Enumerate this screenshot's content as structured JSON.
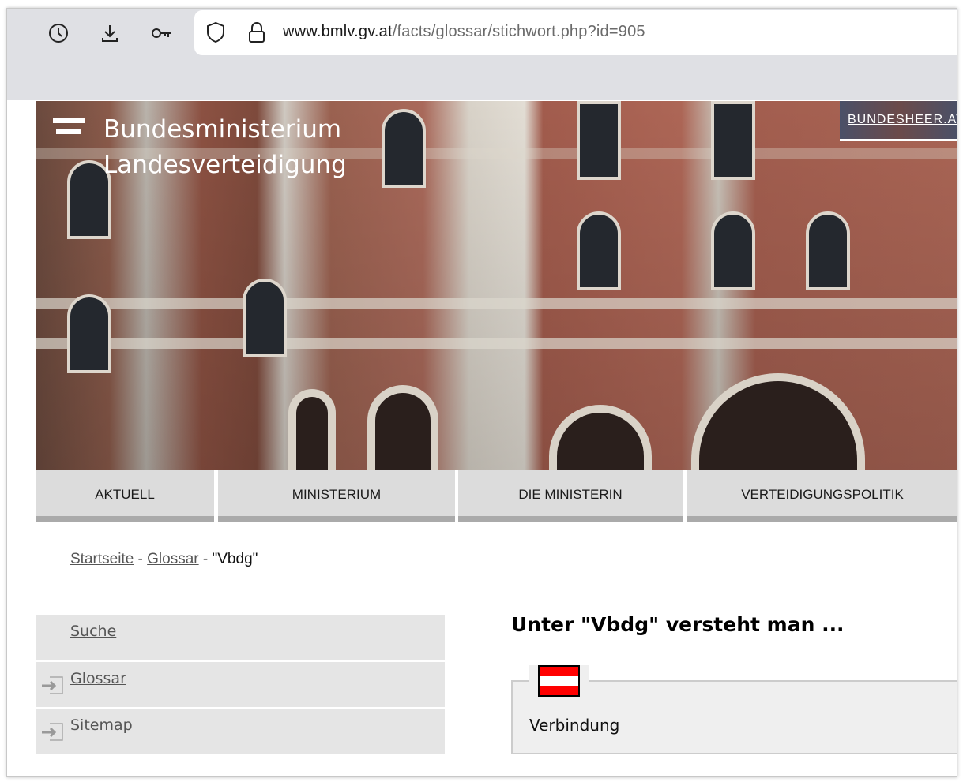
{
  "browser": {
    "url_host": "www.bmlv.gv.at",
    "url_path": "/facts/glossar/stichwort.php?id=905",
    "icons": [
      "history-icon",
      "download-icon",
      "key-icon",
      "shield-icon",
      "lock-icon"
    ]
  },
  "header": {
    "logo_line1": "Bundesministerium",
    "logo_line2": "Landesverteidigung",
    "external_link": "BUNDESHEER.AT"
  },
  "nav": [
    "AKTUELL",
    "MINISTERIUM",
    "DIE MINISTERIN",
    "VERTEIDIGUNGSPOLITIK"
  ],
  "breadcrumb": {
    "items": [
      "Startseite",
      "Glossar"
    ],
    "sep": "-",
    "current": "\"Vbdg\""
  },
  "sidebar": [
    "Suche",
    "Glossar",
    "Sitemap"
  ],
  "content": {
    "heading": "Unter \"Vbdg\" versteht man ...",
    "definition": "Verbindung"
  },
  "colors": {
    "flag_red": "#ff0000",
    "nav_bg": "#dcdcdc",
    "sidebar_bg": "#e5e5e5"
  }
}
